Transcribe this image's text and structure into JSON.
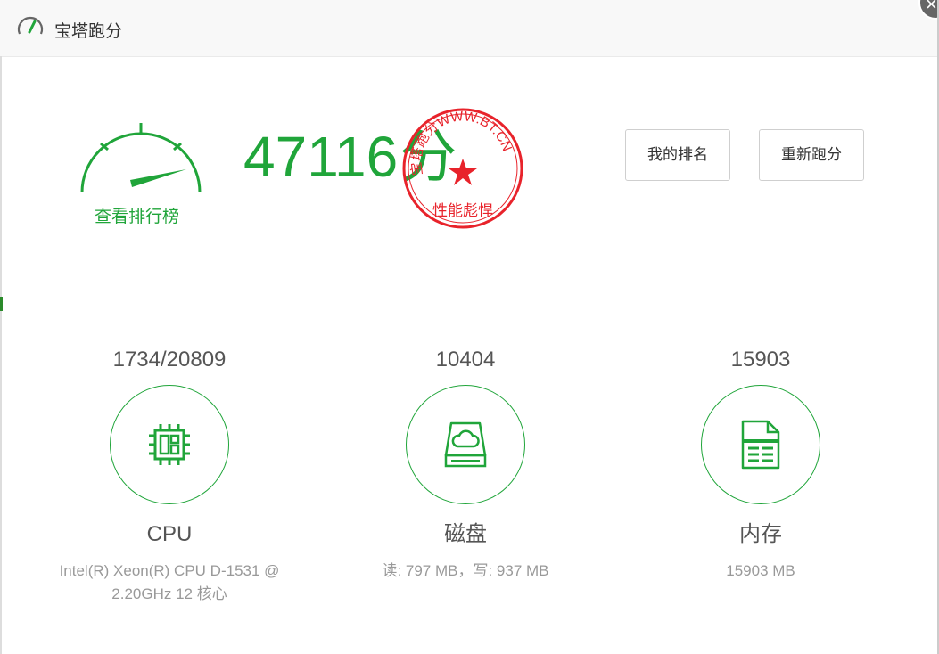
{
  "window": {
    "title": "宝塔跑分",
    "close_glyph": "×"
  },
  "header": {
    "rank_link": "查看排行榜",
    "score_value": "47116",
    "score_unit": "分",
    "stamp_text_top": "宝塔跑分WWW.BT.CN",
    "stamp_text_bottom": "性能彪悍",
    "my_rank_button": "我的排名",
    "rerun_button": "重新跑分"
  },
  "metrics": {
    "cpu": {
      "value": "1734/20809",
      "name": "CPU",
      "desc_line1": "Intel(R) Xeon(R) CPU D-1531 @",
      "desc_line2": "2.20GHz 12 核心",
      "icon": "cpu-chip-icon"
    },
    "disk": {
      "value": "10404",
      "name": "磁盘",
      "desc_line1": "读: 797 MB，写: 937 MB",
      "icon": "disk-cloud-icon"
    },
    "memory": {
      "value": "15903",
      "name": "内存",
      "desc_line1": "15903 MB",
      "icon": "memory-document-icon"
    }
  },
  "colors": {
    "accent": "#20a53a",
    "stamp": "#e8232b",
    "text": "#555555",
    "muted": "#999999"
  }
}
